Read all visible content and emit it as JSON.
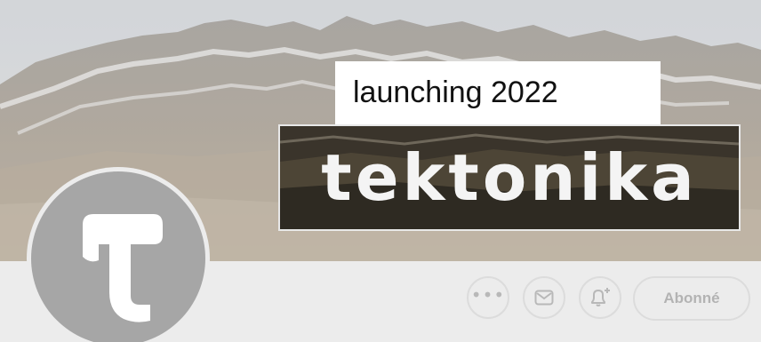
{
  "cover": {
    "tagline": "launching 2022",
    "brand_logo_text": "tektonika"
  },
  "profile": {
    "avatar_letter": "T"
  },
  "actions": {
    "more_icon": "ellipsis-icon",
    "mail_icon": "envelope-icon",
    "bell_icon": "bell-plus-icon",
    "subscribed_label": "Abonné"
  },
  "colors": {
    "background": "#ececec",
    "avatar": "#a6a6a6",
    "button_border": "#dcdcdc",
    "button_text": "#b3b3b3"
  }
}
